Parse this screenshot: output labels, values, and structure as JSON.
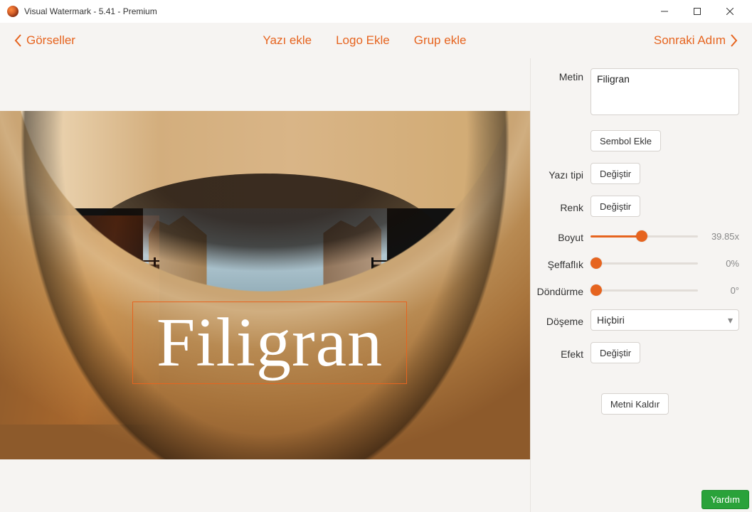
{
  "window": {
    "title": "Visual Watermark - 5.41 - Premium"
  },
  "toolbar": {
    "back": "Görseller",
    "tabs": {
      "text": "Yazı ekle",
      "logo": "Logo Ekle",
      "group": "Grup ekle"
    },
    "next": "Sonraki Adım"
  },
  "watermark": {
    "text": "Filigran"
  },
  "panel": {
    "text": {
      "label": "Metin",
      "value": "Filigran",
      "add_symbol": "Sembol Ekle"
    },
    "font": {
      "label": "Yazı tipi",
      "change": "Değiştir"
    },
    "color": {
      "label": "Renk",
      "change": "Değiştir"
    },
    "size": {
      "label": "Boyut",
      "value": "39.85x",
      "percent": 48
    },
    "opacity": {
      "label": "Şeffaflık",
      "value": "0%",
      "percent": 0
    },
    "rotate": {
      "label": "Döndürme",
      "value": "0°",
      "percent": 0
    },
    "tile": {
      "label": "Döşeme",
      "selected": "Hiçbiri"
    },
    "effect": {
      "label": "Efekt",
      "change": "Değiştir"
    },
    "remove": "Metni Kaldır"
  },
  "help": {
    "label": "Yardım"
  }
}
